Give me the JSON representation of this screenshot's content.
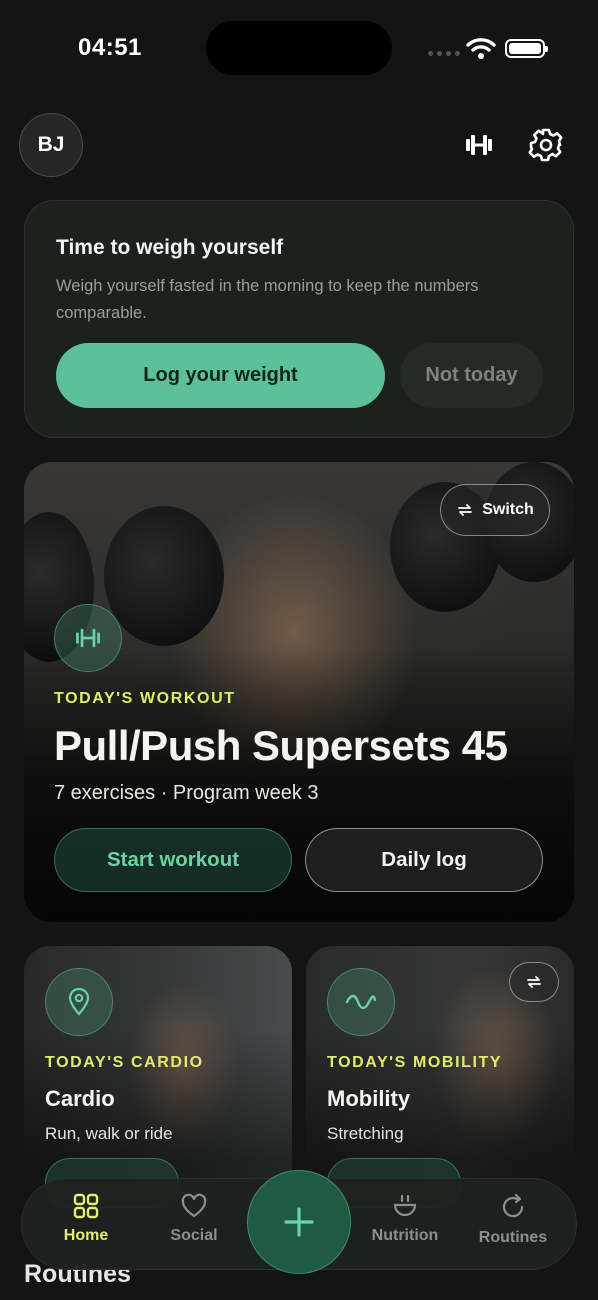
{
  "status_bar": {
    "time": "04:51"
  },
  "header": {
    "avatar_initials": "BJ"
  },
  "weigh_card": {
    "title": "Time to weigh yourself",
    "description": "Weigh yourself fasted in the morning to keep the numbers comparable.",
    "primary_label": "Log your weight",
    "secondary_label": "Not today"
  },
  "workout": {
    "switch_label": "Switch",
    "kicker": "TODAY'S WORKOUT",
    "title": "Pull/Push Supersets 45",
    "subtitle": "7 exercises · Program week 3",
    "start_label": "Start workout",
    "daily_log_label": "Daily log"
  },
  "cardio": {
    "kicker": "TODAY'S CARDIO",
    "title": "Cardio",
    "subtitle": "Run, walk or ride"
  },
  "mobility": {
    "kicker": "TODAY'S MOBILITY",
    "title": "Mobility",
    "subtitle": "Stretching"
  },
  "routines_heading": "Routines",
  "tabs": [
    {
      "label": "Home",
      "icon": "grid-icon",
      "active": true
    },
    {
      "label": "Social",
      "icon": "heart-icon",
      "active": false
    },
    {
      "label": "Nutrition",
      "icon": "bowl-icon",
      "active": false
    },
    {
      "label": "Routines",
      "icon": "refresh-icon",
      "active": false
    }
  ],
  "colors": {
    "accent_green": "#5cc098",
    "accent_yellow": "#e3ee6c",
    "background": "#141414"
  }
}
